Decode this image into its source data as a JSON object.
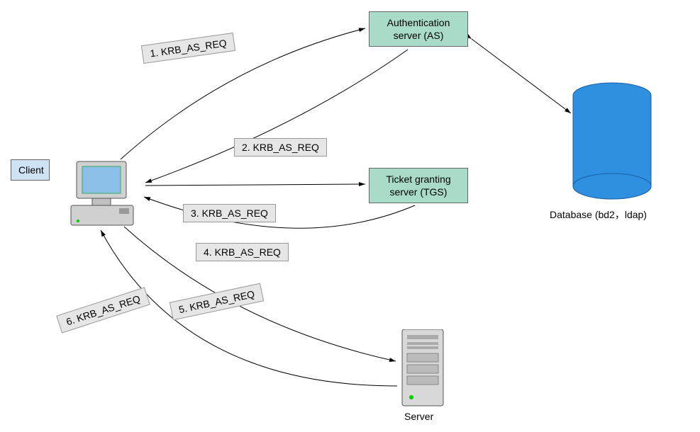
{
  "nodes": {
    "client": "Client",
    "as_line1": "Authentication",
    "as_line2": "server (AS)",
    "tgs_line1": "Ticket granting",
    "tgs_line2": "server (TGS)",
    "server": "Server",
    "database": "Database (bd2，ldap)"
  },
  "messages": {
    "m1": "1. KRB_AS_REQ",
    "m2": "2. KRB_AS_REQ",
    "m3": "3. KRB_AS_REQ",
    "m4": "4. KRB_AS_REQ",
    "m5": "5. KRB_AS_REQ",
    "m6": "6. KRB_AS_REQ"
  }
}
